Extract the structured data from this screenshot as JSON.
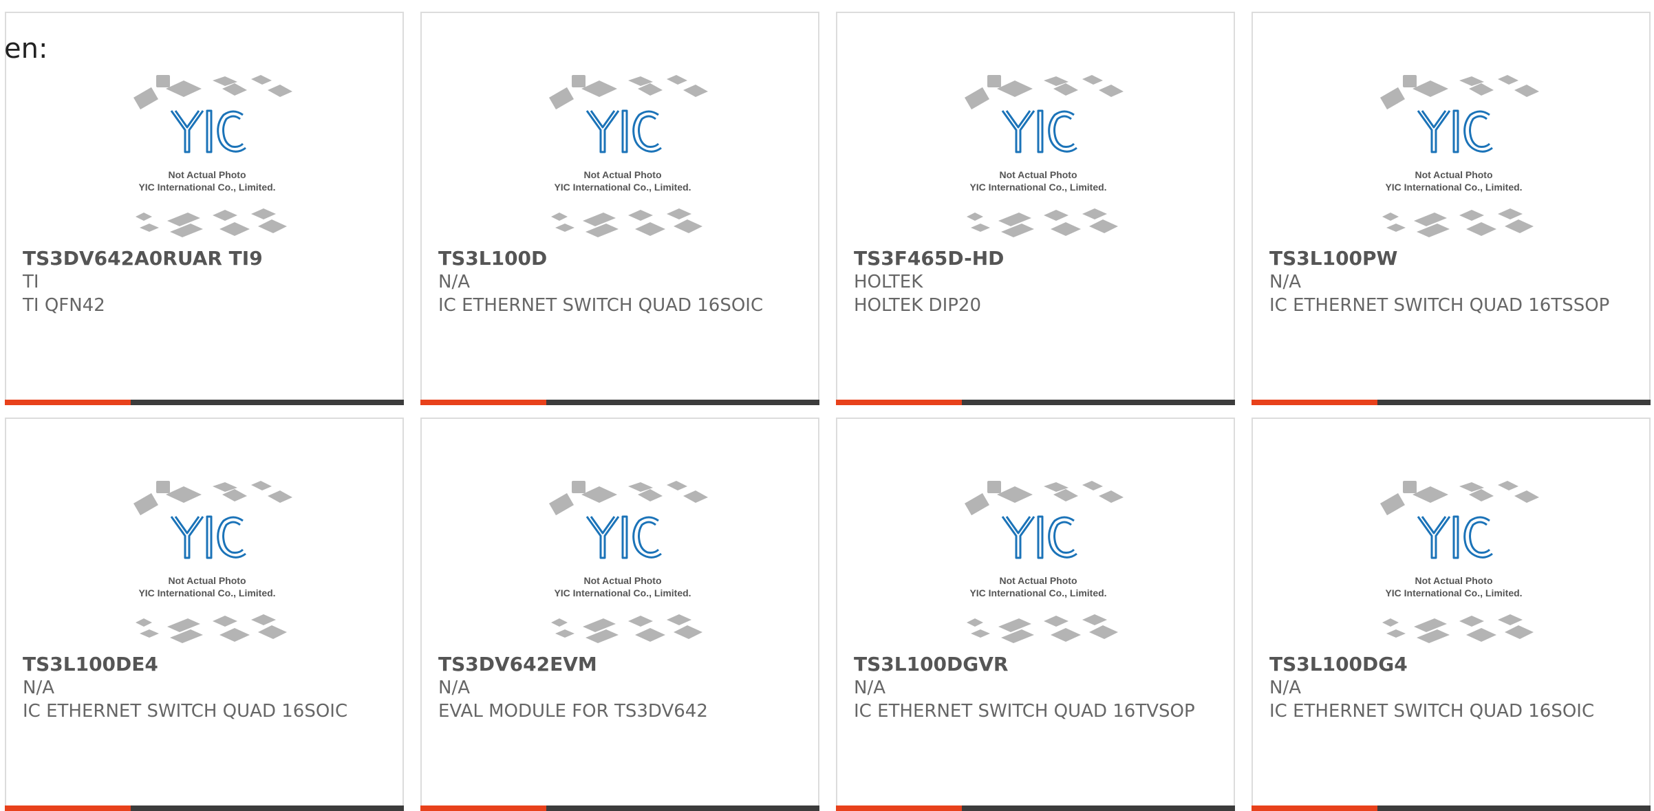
{
  "page": {
    "lang_prefix": "en:"
  },
  "placeholder_image": {
    "line1": "Not Actual Photo",
    "line2": "YIC International Co., Limited.",
    "logo_text": "YIC"
  },
  "colors": {
    "accent": "#e8411b",
    "bar": "#3c3c3c",
    "logo": "#1b73b8",
    "text": "#666666",
    "chip_gray": "#b4b4b4"
  },
  "products": [
    {
      "part": "TS3DV642A0RUAR TI9",
      "manufacturer": "TI",
      "description": "TI QFN42"
    },
    {
      "part": "TS3L100D",
      "manufacturer": "N/A",
      "description": "IC ETHERNET SWITCH QUAD 16SOIC"
    },
    {
      "part": "TS3F465D-HD",
      "manufacturer": "HOLTEK",
      "description": "HOLTEK DIP20"
    },
    {
      "part": "TS3L100PW",
      "manufacturer": "N/A",
      "description": "IC ETHERNET SWITCH QUAD 16TSSOP"
    },
    {
      "part": "TS3L100DE4",
      "manufacturer": "N/A",
      "description": "IC ETHERNET SWITCH QUAD 16SOIC"
    },
    {
      "part": "TS3DV642EVM",
      "manufacturer": "N/A",
      "description": "EVAL MODULE FOR TS3DV642"
    },
    {
      "part": "TS3L100DGVR",
      "manufacturer": "N/A",
      "description": "IC ETHERNET SWITCH QUAD 16TVSOP"
    },
    {
      "part": "TS3L100DG4",
      "manufacturer": "N/A",
      "description": "IC ETHERNET SWITCH QUAD 16SOIC"
    }
  ]
}
